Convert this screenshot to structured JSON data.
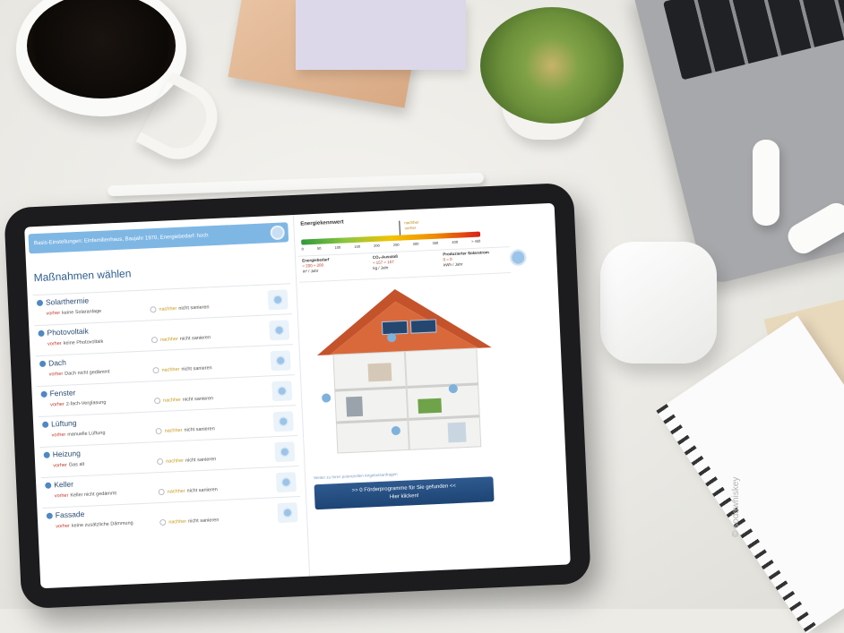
{
  "base_settings": {
    "label": "Basis-Einstellungen",
    "summary": "Einfamilienhaus, Baujahr 1970, Energiebedarf: hoch"
  },
  "page_title": "Maßnahmen wählen",
  "measures": [
    {
      "name": "Solarthermie",
      "current_label": "vorher",
      "current_value": "keine Solaranlage",
      "planned_label": "nachher",
      "planned_value": "nicht sanieren"
    },
    {
      "name": "Photovoltaik",
      "current_label": "vorher",
      "current_value": "keine Photovoltaik",
      "planned_label": "nachher",
      "planned_value": "nicht sanieren"
    },
    {
      "name": "Dach",
      "current_label": "vorher",
      "current_value": "Dach nicht gedämmt",
      "planned_label": "nachher",
      "planned_value": "nicht sanieren"
    },
    {
      "name": "Fenster",
      "current_label": "vorher",
      "current_value": "2-fach-Verglasung",
      "planned_label": "nachher",
      "planned_value": "nicht sanieren"
    },
    {
      "name": "Lüftung",
      "current_label": "vorher",
      "current_value": "manuelle Lüftung",
      "planned_label": "nachher",
      "planned_value": "nicht sanieren"
    },
    {
      "name": "Heizung",
      "current_label": "vorher",
      "current_value": "Gas alt",
      "planned_label": "nachher",
      "planned_value": "nicht sanieren"
    },
    {
      "name": "Keller",
      "current_label": "vorher",
      "current_value": "Keller nicht gedämmt",
      "planned_label": "nachher",
      "planned_value": "nicht sanieren"
    },
    {
      "name": "Fassade",
      "current_label": "vorher",
      "current_value": "keine zusätzliche Dämmung",
      "planned_label": "nachher",
      "planned_value": "nicht sanieren"
    }
  ],
  "energy": {
    "title": "Energiekennwert",
    "marker_after": "nachher",
    "marker_before": "vorher",
    "marker_value": 260,
    "ticks": [
      "0",
      "50",
      "100",
      "150",
      "200",
      "250",
      "300",
      "350",
      "400",
      "> 450"
    ],
    "kpis": [
      {
        "title": "Energiebedarf",
        "value": "≈ 200 ≈ 200",
        "unit": "m² / Jahr"
      },
      {
        "title": "CO₂-Ausstoß",
        "value": "≈ 157 ≈ 157",
        "unit": "kg / Jahr"
      },
      {
        "title": "Produzierter Solarstrom",
        "value": "0 ≈ 0",
        "unit": "kWh / Jahr"
      }
    ]
  },
  "link_text": "Weiter zu Ihren potenziellen Angebotsanfragen",
  "cta": {
    "line1": ">> 0 Förderprogramme für Sie gefunden <<",
    "line2": "Hier klicken!"
  },
  "photo_credit": "© sodawhiskey",
  "colors": {
    "accent_blue": "#2f5a8f",
    "header_blue": "#7fb7e4",
    "before_red": "#c0392b",
    "after_gold": "#c89b1e"
  }
}
